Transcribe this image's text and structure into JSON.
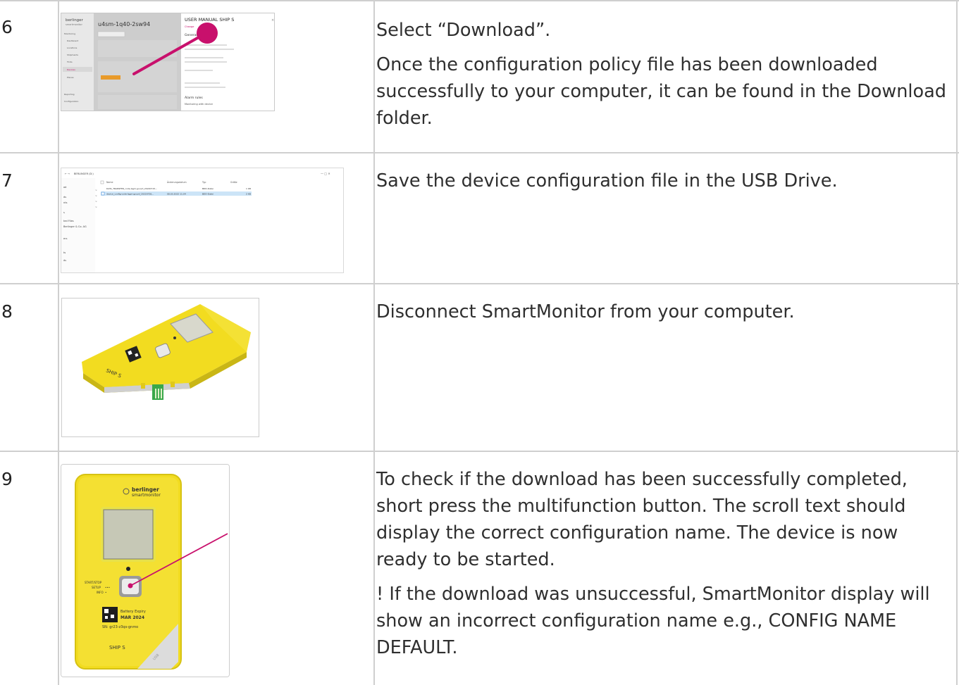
{
  "steps": [
    {
      "number": "6",
      "paragraphs": [
        "Select “Download”.",
        "Once the configuration policy file has been downloaded successfully to your computer, it can be found in the Download folder."
      ]
    },
    {
      "number": "7",
      "paragraphs": [
        "Save the device configuration file in the USB Drive."
      ]
    },
    {
      "number": "8",
      "paragraphs": [
        "Disconnect SmartMonitor from your computer."
      ]
    },
    {
      "number": "9",
      "paragraphs": [
        "To check if the download has been successfully completed, short press the multifunction button. The scroll text should display the correct configuration name. The device is now ready to be started.",
        "! If the download was unsuccessful, SmartMonitor display will show an incorrect configuration name e.g., CONFIG NAME DEFAULT."
      ]
    }
  ],
  "shot6": {
    "brand": "berlinger",
    "brand_sub": "smartmonitor",
    "device_id": "u4sm-1q40-2sw94",
    "panel_title": "USER MANUAL SHIP S",
    "change_label": "Change",
    "download_label": "Download",
    "general_heading": "General",
    "alarm_rules_heading": "Alarm rules",
    "alarm_rules_text": "Monitoring with device",
    "sidebar_items": [
      "Monitoring",
      "Dashboard",
      "Locations",
      "Shipments",
      "TCUs",
      "Devices",
      "Places",
      "Reporting",
      "Configuration"
    ]
  },
  "shot7": {
    "path_label": "BERLINGER (D:)",
    "col_name": "Name",
    "col_modified": "Änderungsdatum",
    "col_type": "Typ",
    "col_size": "Größe",
    "files": [
      {
        "name": "DATA_TRANSFER_code-lsgm-gouvd_20220715...",
        "modified": "",
        "type": "BDD-Datei",
        "size": "1 KB"
      },
      {
        "name": "device_config-code-lsgm-gouvd_20220726...",
        "modified": "08.03.2022 11:04",
        "type": "BDD-Datei",
        "size": "2 KB"
      }
    ],
    "nav_items": [
      "Berlinger & Co. AG"
    ]
  },
  "shot9": {
    "brand": "berlinger",
    "brand_sub": "smartmonitor",
    "start_stop": "START/STOP",
    "setup": "SETUP",
    "info": "INFO",
    "expiry_label": "Battery Expiry",
    "expiry_date": "MAR 2024",
    "serial": "SN: gr23-z3qs-gnmo",
    "model": "SHIP S"
  },
  "colors": {
    "accent_pink": "#c8106c",
    "device_yellow": "#f2dc20",
    "grid_line": "#cfcfcf"
  }
}
